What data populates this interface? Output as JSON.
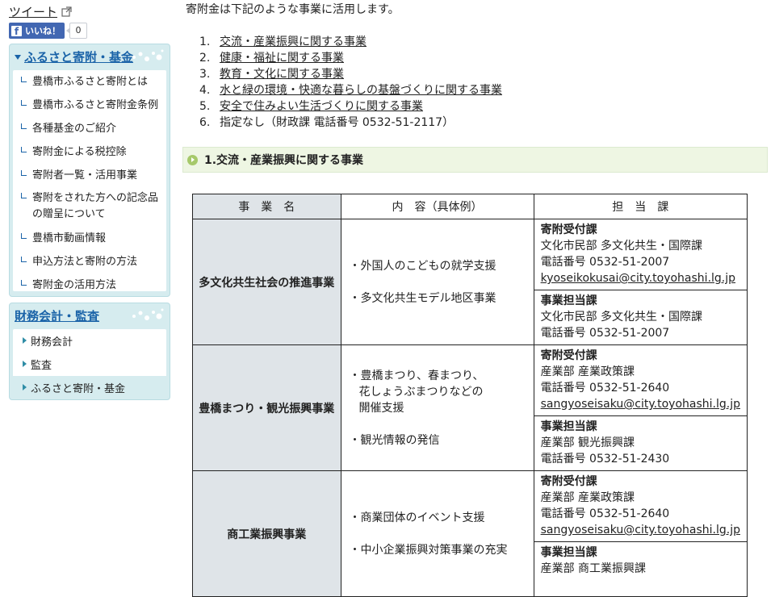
{
  "social": {
    "tweet_label": "ツイート",
    "like_label": "いいね！",
    "like_count": "0"
  },
  "sidebar": {
    "box1": {
      "title": "ふるさと寄附・基金",
      "items": [
        "豊橋市ふるさと寄附とは",
        "豊橋市ふるさと寄附金条例",
        "各種基金のご紹介",
        "寄附金による税控除",
        "寄附者一覧・活用事業",
        "寄附をされた方への記念品の贈呈について",
        "豊橋市動画情報",
        "申込方法と寄附の方法",
        "寄附金の活用方法"
      ]
    },
    "box2": {
      "title": "財務会計・監査",
      "items": [
        "財務会計",
        "監査",
        "ふるさと寄附・基金"
      ]
    }
  },
  "main": {
    "intro": "寄附金は下記のような事業に活用します。",
    "purposes": [
      {
        "num": "1.",
        "label": "交流・産業振興に関する事業",
        "link": true
      },
      {
        "num": "2.",
        "label": "健康・福祉に関する事業",
        "link": true
      },
      {
        "num": "3.",
        "label": "教育・文化に関する事業",
        "link": true
      },
      {
        "num": "4.",
        "label": "水と緑の環境・快適な暮らしの基盤づくりに関する事業",
        "link": true
      },
      {
        "num": "5.",
        "label": "安全で住みよい生活づくりに関する事業",
        "link": true
      },
      {
        "num": "6.",
        "label": "指定なし（財政課 電話番号 0532-51-2117）",
        "link": false
      }
    ],
    "section_title": "1.交流・産業振興に関する事業",
    "table": {
      "headers": [
        "事　業　名",
        "内　容（具体例）",
        "担　当　課"
      ],
      "rows": [
        {
          "name": "多文化共生社会の推進事業",
          "contents": [
            "・外国人のこどもの就学支援",
            "・多文化共生モデル地区事業"
          ],
          "dept1": {
            "role": "寄附受付課",
            "division": "文化市民部 多文化共生・国際課",
            "phone": "電話番号 0532-51-2007",
            "email": "kyoseikokusai@city.toyohashi.lg.jp"
          },
          "dept2": {
            "role": "事業担当課",
            "division": "文化市民部 多文化共生・国際課",
            "phone": "電話番号 0532-51-2007"
          }
        },
        {
          "name": "豊橋まつり・観光振興事業",
          "contents_lines": [
            "・豊橋まつり、春まつり、",
            "花しょうぶまつりなどの",
            "開催支援"
          ],
          "contents2": "・観光情報の発信",
          "dept1": {
            "role": "寄附受付課",
            "division": "産業部 産業政策課",
            "phone": "電話番号 0532-51-2640",
            "email": "sangyoseisaku@city.toyohashi.lg.jp"
          },
          "dept2": {
            "role": "事業担当課",
            "division": "産業部 観光振興課",
            "phone": "電話番号 0532-51-2430"
          }
        },
        {
          "name": "商工業振興事業",
          "contents": [
            "・商業団体のイベント支援",
            "・中小企業振興対策事業の充実"
          ],
          "dept1": {
            "role": "寄附受付課",
            "division": "産業部 産業政策課",
            "phone": "電話番号 0532-51-2640",
            "email": "sangyoseisaku@city.toyohashi.lg.jp"
          },
          "dept2": {
            "role": "事業担当課",
            "division": "産業部 商工業振興課"
          }
        }
      ]
    }
  }
}
